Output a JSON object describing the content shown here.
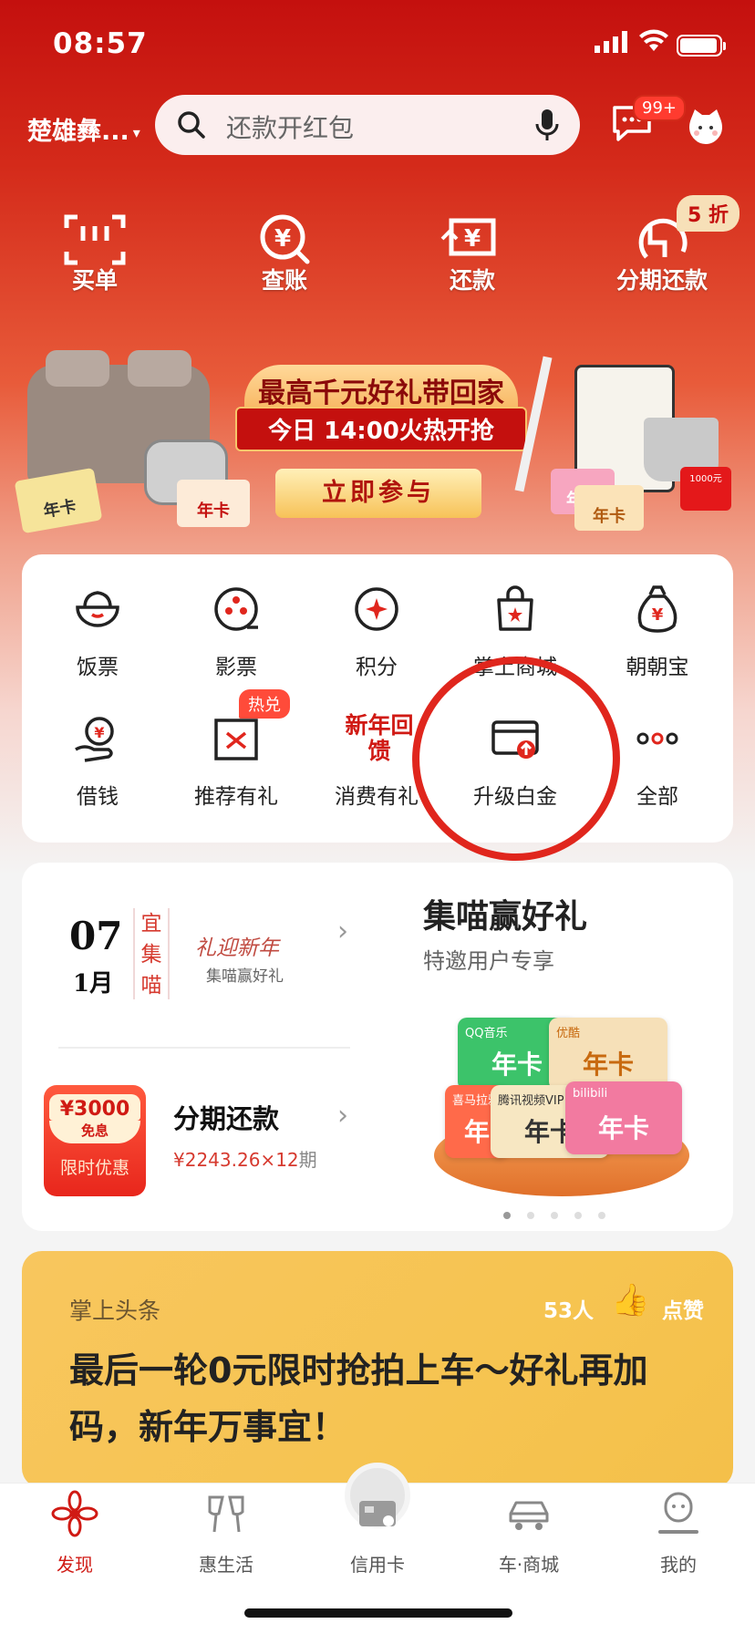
{
  "status_bar": {
    "time": "08:57"
  },
  "header": {
    "city": "楚雄彝...",
    "search_placeholder": "还款开红包",
    "message_badge": "99+"
  },
  "quick_actions": [
    {
      "label": "买单",
      "icon": "scan-pay-icon"
    },
    {
      "label": "查账",
      "icon": "bill-search-icon"
    },
    {
      "label": "还款",
      "icon": "repay-icon"
    },
    {
      "label": "分期还款",
      "icon": "installment-icon",
      "badge": "5 折"
    }
  ],
  "banner": {
    "title": "最高千元好礼带回家",
    "subtitle": "今日 14:00火热开抢",
    "cta": "立即参与",
    "cards": [
      "年卡",
      "年卡",
      "年卡",
      "年卡"
    ],
    "coupon_text": "1000元"
  },
  "services": [
    {
      "label": "饭票",
      "icon": "rice-bowl-icon"
    },
    {
      "label": "影票",
      "icon": "film-reel-icon"
    },
    {
      "label": "积分",
      "icon": "points-star-icon"
    },
    {
      "label": "掌上商城",
      "icon": "shopping-bag-icon"
    },
    {
      "label": "朝朝宝",
      "icon": "money-bag-icon"
    },
    {
      "label": "借钱",
      "icon": "loan-hand-icon"
    },
    {
      "label": "推荐有礼",
      "icon": "gift-box-icon",
      "badge": "热兑"
    },
    {
      "label": "消费有礼",
      "icon": "new-year-icon",
      "icon_text": "新年回馈"
    },
    {
      "label": "升级白金",
      "icon": "card-upgrade-icon"
    },
    {
      "label": "全部",
      "icon": "more-dots-icon"
    }
  ],
  "promo": {
    "date_day": "07",
    "date_month": "1月",
    "yi": [
      "宜",
      "集",
      "喵"
    ],
    "lynx_title": "礼迎新年",
    "lynx_sub": "集喵赢好礼",
    "coupon_amount": "¥3000",
    "coupon_free": "免息",
    "coupon_limit": "限时优惠",
    "installment_title": "分期还款",
    "installment_amount": "¥2243.26×12",
    "installment_period": "期",
    "right_title": "集喵赢好礼",
    "right_sub": "特邀用户专享",
    "year_cards": [
      {
        "brand": "QQ音乐",
        "label": "年卡",
        "color": "#3cc36a"
      },
      {
        "brand": "优酷",
        "label": "年卡",
        "color": "#f6e0b8"
      },
      {
        "brand": "喜马拉雅",
        "label": "年",
        "color": "#ff6a4a"
      },
      {
        "brand": "腾讯视频VIP",
        "label": "年卡",
        "color": "#f7e7c2"
      },
      {
        "brand": "bilibili",
        "label": "年卡",
        "color": "#f27aa0"
      }
    ]
  },
  "news": {
    "tag": "掌上头条",
    "likes": "53人",
    "like_label": "点赞",
    "title": "最后一轮0元限时抢拍上车～好礼再加码，新年万事宜！"
  },
  "tabs": [
    {
      "label": "发现",
      "icon": "discover-flower-icon",
      "active": true
    },
    {
      "label": "惠生活",
      "icon": "cheers-glasses-icon",
      "active": false
    },
    {
      "label": "信用卡",
      "icon": "credit-card-icon",
      "active": false
    },
    {
      "label": "车·商城",
      "icon": "car-icon",
      "active": false
    },
    {
      "label": "我的",
      "icon": "profile-icon",
      "active": false
    }
  ],
  "colors": {
    "brand_red": "#d01a14",
    "annotation_circle": "#e0261d",
    "news_bg": "#f6c451"
  }
}
